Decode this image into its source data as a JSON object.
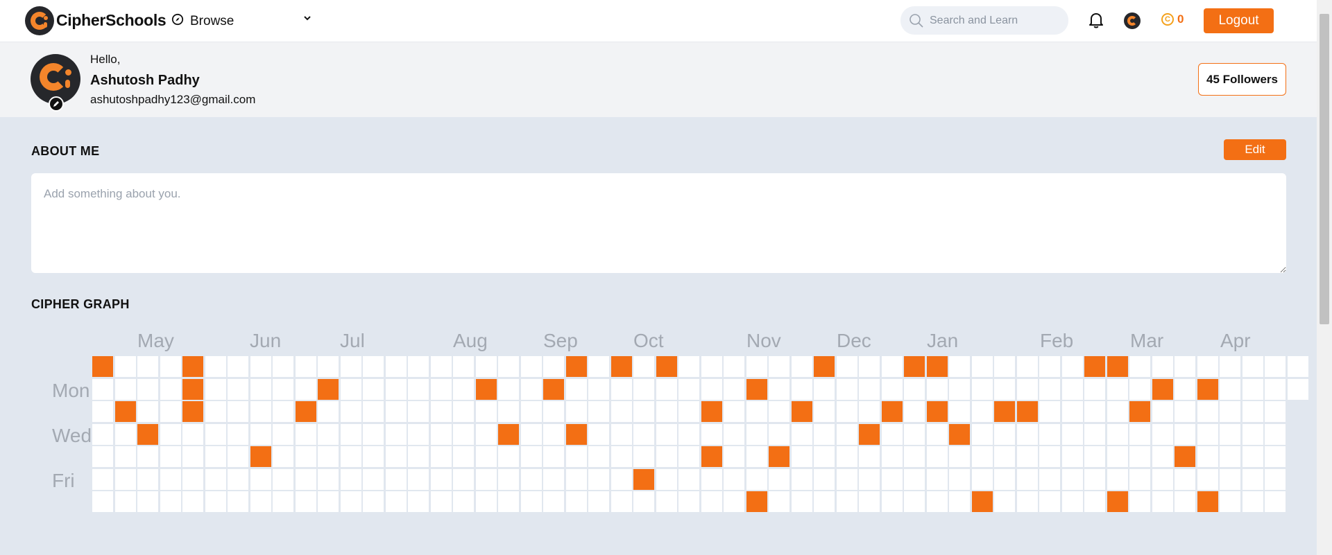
{
  "navbar": {
    "brand": "CipherSchools",
    "browse_label": "Browse",
    "search_placeholder": "Search and Learn",
    "coins": "0",
    "logout_label": "Logout"
  },
  "profile": {
    "greeting": "Hello,",
    "name": "Ashutosh Padhy",
    "email": "ashutoshpadhy123@gmail.com",
    "followers_label": "45 Followers"
  },
  "about": {
    "title": "ABOUT ME",
    "edit_label": "Edit",
    "placeholder": "Add something about you."
  },
  "graph": {
    "title": "CIPHER GRAPH",
    "months": [
      "May",
      "Jun",
      "Jul",
      "Aug",
      "Sep",
      "Oct",
      "Nov",
      "Dec",
      "Jan",
      "Feb",
      "Mar",
      "Apr"
    ],
    "day_labels": [
      "Mon",
      "Wed",
      "Fri"
    ],
    "active_cells": [
      [
        0,
        0
      ],
      [
        4,
        0
      ],
      [
        21,
        0
      ],
      [
        23,
        0
      ],
      [
        25,
        0
      ],
      [
        32,
        0
      ],
      [
        36,
        0
      ],
      [
        37,
        0
      ],
      [
        44,
        0
      ],
      [
        45,
        0
      ],
      [
        4,
        1
      ],
      [
        10,
        1
      ],
      [
        17,
        1
      ],
      [
        20,
        1
      ],
      [
        29,
        1
      ],
      [
        47,
        1
      ],
      [
        49,
        1
      ],
      [
        1,
        2
      ],
      [
        4,
        2
      ],
      [
        9,
        2
      ],
      [
        27,
        2
      ],
      [
        31,
        2
      ],
      [
        35,
        2
      ],
      [
        37,
        2
      ],
      [
        40,
        2
      ],
      [
        41,
        2
      ],
      [
        46,
        2
      ],
      [
        2,
        3
      ],
      [
        18,
        3
      ],
      [
        21,
        3
      ],
      [
        34,
        3
      ],
      [
        38,
        3
      ],
      [
        7,
        4
      ],
      [
        27,
        4
      ],
      [
        30,
        4
      ],
      [
        48,
        4
      ],
      [
        24,
        5
      ],
      [
        29,
        6
      ],
      [
        39,
        6
      ],
      [
        45,
        6
      ],
      [
        49,
        6
      ]
    ]
  },
  "colors": {
    "accent": "#f36f14",
    "background": "#e1e7ef",
    "cell_empty": "#ffffff"
  }
}
